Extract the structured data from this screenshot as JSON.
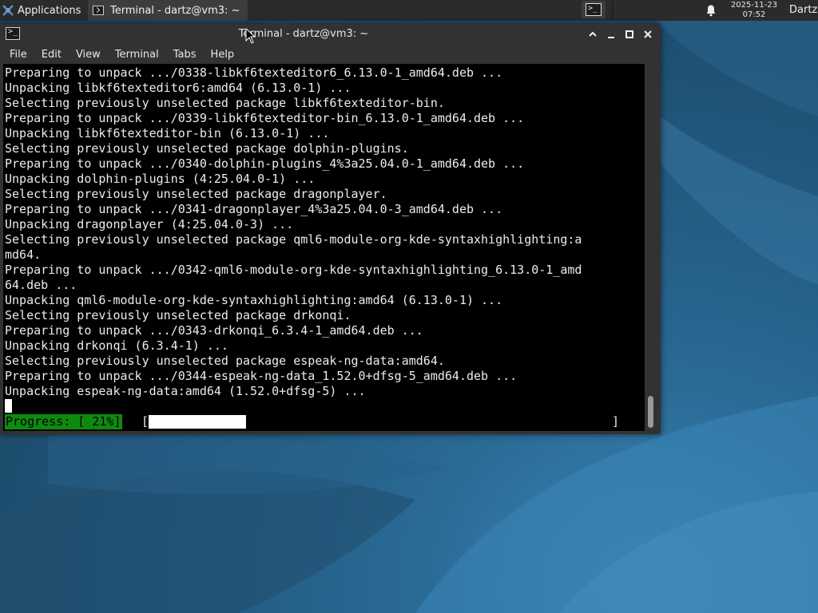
{
  "panel": {
    "applications_label": "Applications",
    "task_label": "Terminal - dartz@vm3: ~",
    "clock_date": "2025-11-23",
    "clock_time": "07:52",
    "user_label": "Dartz",
    "icons": [
      "applications-menu-icon",
      "terminal-icon",
      "bell-icon"
    ]
  },
  "window": {
    "title": "Terminal - dartz@vm3: ~",
    "menu": [
      "File",
      "Edit",
      "View",
      "Terminal",
      "Tabs",
      "Help"
    ],
    "buttons": [
      "chevron-up-icon",
      "minimize-icon",
      "maximize-icon",
      "close-icon"
    ]
  },
  "terminal": {
    "lines": [
      "Preparing to unpack .../0338-libkf6texteditor6_6.13.0-1_amd64.deb ...",
      "Unpacking libkf6texteditor6:amd64 (6.13.0-1) ...",
      "Selecting previously unselected package libkf6texteditor-bin.",
      "Preparing to unpack .../0339-libkf6texteditor-bin_6.13.0-1_amd64.deb ...",
      "Unpacking libkf6texteditor-bin (6.13.0-1) ...",
      "Selecting previously unselected package dolphin-plugins.",
      "Preparing to unpack .../0340-dolphin-plugins_4%3a25.04.0-1_amd64.deb ...",
      "Unpacking dolphin-plugins (4:25.04.0-1) ...",
      "Selecting previously unselected package dragonplayer.",
      "Preparing to unpack .../0341-dragonplayer_4%3a25.04.0-3_amd64.deb ...",
      "Unpacking dragonplayer (4:25.04.0-3) ...",
      "Selecting previously unselected package qml6-module-org-kde-syntaxhighlighting:a",
      "md64.",
      "Preparing to unpack .../0342-qml6-module-org-kde-syntaxhighlighting_6.13.0-1_amd",
      "64.deb ...",
      "Unpacking qml6-module-org-kde-syntaxhighlighting:amd64 (6.13.0-1) ...",
      "Selecting previously unselected package drkonqi.",
      "Preparing to unpack .../0343-drkonqi_6.3.4-1_amd64.deb ...",
      "Unpacking drkonqi (6.3.4-1) ...",
      "Selecting previously unselected package espeak-ng-data:amd64.",
      "Preparing to unpack .../0344-espeak-ng-data_1.52.0+dfsg-5_amd64.deb ...",
      "Unpacking espeak-ng-data:amd64 (1.52.0+dfsg-5) ..."
    ],
    "progress_label": "Progress: [ 21%]",
    "progress_open": "[",
    "progress_close": "]",
    "progress_fraction": 0.21
  },
  "colors": {
    "progress_bg": "#0f8a0f",
    "terminal_bg": "#000000",
    "panel_bg": "#2b2b2b",
    "window_bg": "#323232"
  }
}
